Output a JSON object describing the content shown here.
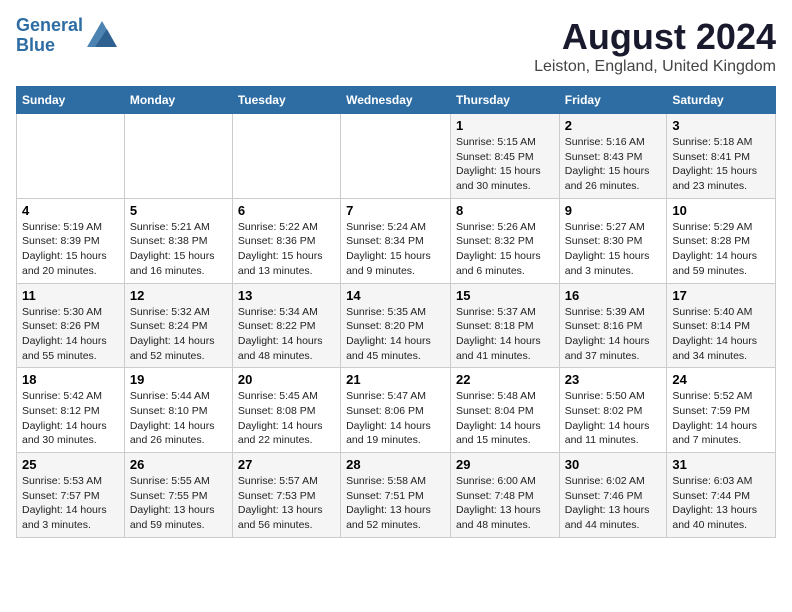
{
  "logo": {
    "line1": "General",
    "line2": "Blue"
  },
  "title": "August 2024",
  "subtitle": "Leiston, England, United Kingdom",
  "days_of_week": [
    "Sunday",
    "Monday",
    "Tuesday",
    "Wednesday",
    "Thursday",
    "Friday",
    "Saturday"
  ],
  "weeks": [
    [
      {
        "day": "",
        "info": ""
      },
      {
        "day": "",
        "info": ""
      },
      {
        "day": "",
        "info": ""
      },
      {
        "day": "",
        "info": ""
      },
      {
        "day": "1",
        "info": "Sunrise: 5:15 AM\nSunset: 8:45 PM\nDaylight: 15 hours\nand 30 minutes."
      },
      {
        "day": "2",
        "info": "Sunrise: 5:16 AM\nSunset: 8:43 PM\nDaylight: 15 hours\nand 26 minutes."
      },
      {
        "day": "3",
        "info": "Sunrise: 5:18 AM\nSunset: 8:41 PM\nDaylight: 15 hours\nand 23 minutes."
      }
    ],
    [
      {
        "day": "4",
        "info": "Sunrise: 5:19 AM\nSunset: 8:39 PM\nDaylight: 15 hours\nand 20 minutes."
      },
      {
        "day": "5",
        "info": "Sunrise: 5:21 AM\nSunset: 8:38 PM\nDaylight: 15 hours\nand 16 minutes."
      },
      {
        "day": "6",
        "info": "Sunrise: 5:22 AM\nSunset: 8:36 PM\nDaylight: 15 hours\nand 13 minutes."
      },
      {
        "day": "7",
        "info": "Sunrise: 5:24 AM\nSunset: 8:34 PM\nDaylight: 15 hours\nand 9 minutes."
      },
      {
        "day": "8",
        "info": "Sunrise: 5:26 AM\nSunset: 8:32 PM\nDaylight: 15 hours\nand 6 minutes."
      },
      {
        "day": "9",
        "info": "Sunrise: 5:27 AM\nSunset: 8:30 PM\nDaylight: 15 hours\nand 3 minutes."
      },
      {
        "day": "10",
        "info": "Sunrise: 5:29 AM\nSunset: 8:28 PM\nDaylight: 14 hours\nand 59 minutes."
      }
    ],
    [
      {
        "day": "11",
        "info": "Sunrise: 5:30 AM\nSunset: 8:26 PM\nDaylight: 14 hours\nand 55 minutes."
      },
      {
        "day": "12",
        "info": "Sunrise: 5:32 AM\nSunset: 8:24 PM\nDaylight: 14 hours\nand 52 minutes."
      },
      {
        "day": "13",
        "info": "Sunrise: 5:34 AM\nSunset: 8:22 PM\nDaylight: 14 hours\nand 48 minutes."
      },
      {
        "day": "14",
        "info": "Sunrise: 5:35 AM\nSunset: 8:20 PM\nDaylight: 14 hours\nand 45 minutes."
      },
      {
        "day": "15",
        "info": "Sunrise: 5:37 AM\nSunset: 8:18 PM\nDaylight: 14 hours\nand 41 minutes."
      },
      {
        "day": "16",
        "info": "Sunrise: 5:39 AM\nSunset: 8:16 PM\nDaylight: 14 hours\nand 37 minutes."
      },
      {
        "day": "17",
        "info": "Sunrise: 5:40 AM\nSunset: 8:14 PM\nDaylight: 14 hours\nand 34 minutes."
      }
    ],
    [
      {
        "day": "18",
        "info": "Sunrise: 5:42 AM\nSunset: 8:12 PM\nDaylight: 14 hours\nand 30 minutes."
      },
      {
        "day": "19",
        "info": "Sunrise: 5:44 AM\nSunset: 8:10 PM\nDaylight: 14 hours\nand 26 minutes."
      },
      {
        "day": "20",
        "info": "Sunrise: 5:45 AM\nSunset: 8:08 PM\nDaylight: 14 hours\nand 22 minutes."
      },
      {
        "day": "21",
        "info": "Sunrise: 5:47 AM\nSunset: 8:06 PM\nDaylight: 14 hours\nand 19 minutes."
      },
      {
        "day": "22",
        "info": "Sunrise: 5:48 AM\nSunset: 8:04 PM\nDaylight: 14 hours\nand 15 minutes."
      },
      {
        "day": "23",
        "info": "Sunrise: 5:50 AM\nSunset: 8:02 PM\nDaylight: 14 hours\nand 11 minutes."
      },
      {
        "day": "24",
        "info": "Sunrise: 5:52 AM\nSunset: 7:59 PM\nDaylight: 14 hours\nand 7 minutes."
      }
    ],
    [
      {
        "day": "25",
        "info": "Sunrise: 5:53 AM\nSunset: 7:57 PM\nDaylight: 14 hours\nand 3 minutes."
      },
      {
        "day": "26",
        "info": "Sunrise: 5:55 AM\nSunset: 7:55 PM\nDaylight: 13 hours\nand 59 minutes."
      },
      {
        "day": "27",
        "info": "Sunrise: 5:57 AM\nSunset: 7:53 PM\nDaylight: 13 hours\nand 56 minutes."
      },
      {
        "day": "28",
        "info": "Sunrise: 5:58 AM\nSunset: 7:51 PM\nDaylight: 13 hours\nand 52 minutes."
      },
      {
        "day": "29",
        "info": "Sunrise: 6:00 AM\nSunset: 7:48 PM\nDaylight: 13 hours\nand 48 minutes."
      },
      {
        "day": "30",
        "info": "Sunrise: 6:02 AM\nSunset: 7:46 PM\nDaylight: 13 hours\nand 44 minutes."
      },
      {
        "day": "31",
        "info": "Sunrise: 6:03 AM\nSunset: 7:44 PM\nDaylight: 13 hours\nand 40 minutes."
      }
    ]
  ]
}
